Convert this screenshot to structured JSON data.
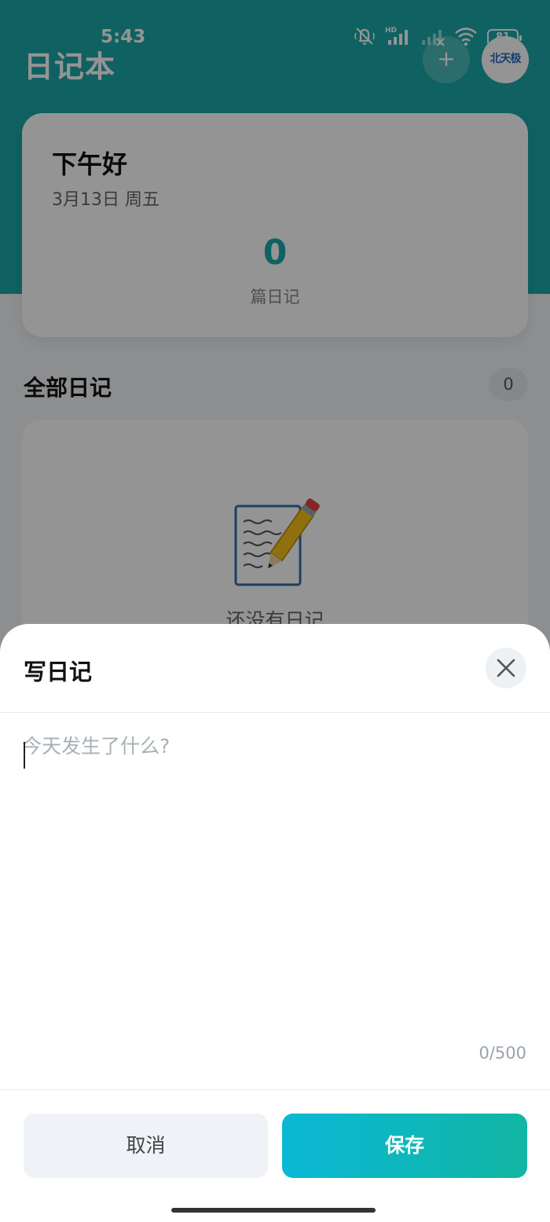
{
  "status_bar": {
    "time": "5:43",
    "battery": "81",
    "hd_label": "HD",
    "icons": [
      "mute-bell-icon",
      "hd-signal-icon",
      "signal-weak-icon",
      "wifi-icon",
      "battery-icon"
    ]
  },
  "header": {
    "title": "日记本",
    "add_label": "+",
    "avatar_text": "北天极"
  },
  "greeting": {
    "title": "下午好",
    "date": "3月13日 周五",
    "count": "0",
    "count_label": "篇日记"
  },
  "list": {
    "title": "全部日记",
    "badge": "0",
    "empty_text": "还没有日记",
    "empty_icon": "notepad-pencil-icon"
  },
  "dialog": {
    "title": "写日记",
    "close_icon": "close-icon",
    "input_value": "",
    "input_placeholder": "今天发生了什么?",
    "char_count": "0/500",
    "cancel_label": "取消",
    "save_label": "保存"
  },
  "colors": {
    "primary": "#1aa7aa",
    "save_gradient_start": "#0ab8d6",
    "save_gradient_end": "#12b6a2",
    "cancel_bg": "#eff3f7",
    "overlay": "rgba(0,0,0,0.42)"
  }
}
